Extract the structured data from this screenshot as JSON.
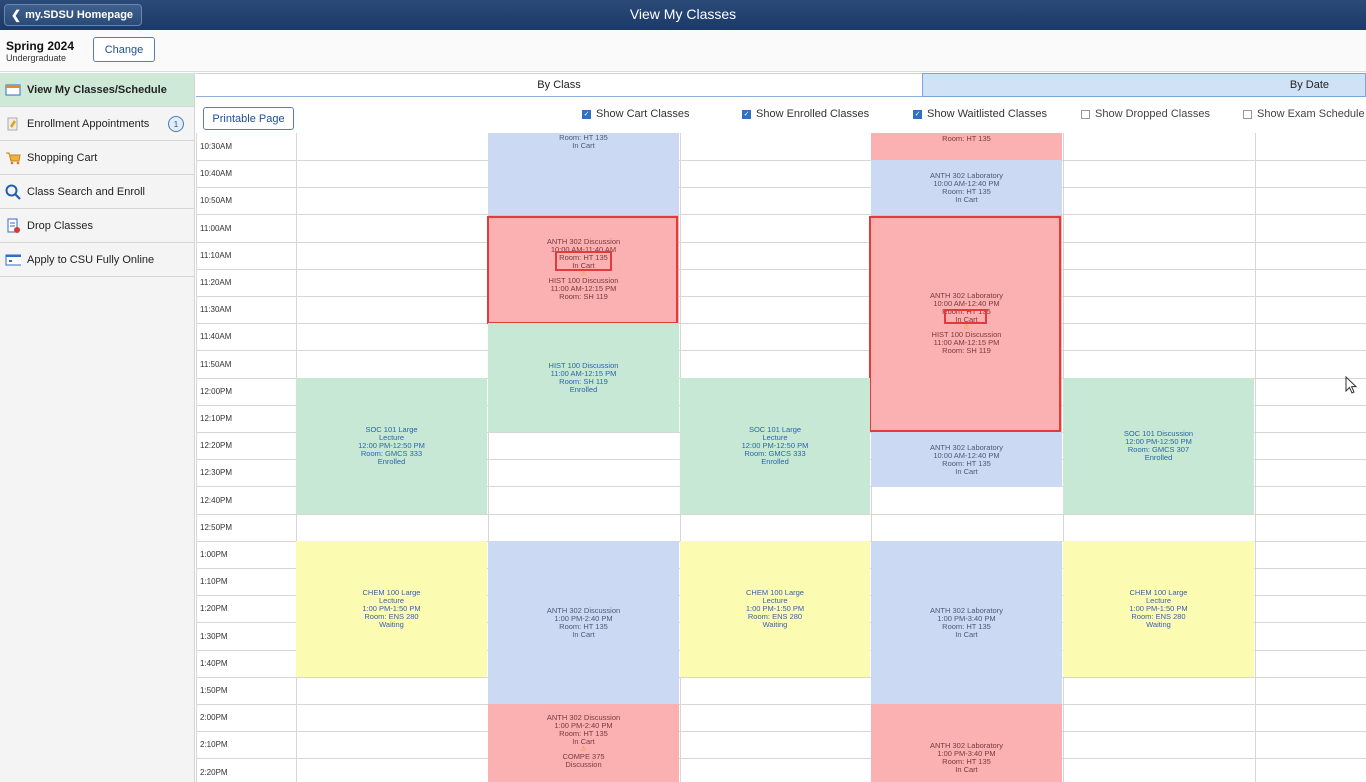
{
  "header": {
    "back_label": "my.SDSU Homepage",
    "title": "View My Classes"
  },
  "term": {
    "name": "Spring 2024",
    "career": "Undergraduate",
    "change_label": "Change"
  },
  "sidebar": {
    "items": [
      {
        "label": "View My Classes/Schedule",
        "icon": "calendar-icon"
      },
      {
        "label": "Enrollment Appointments",
        "icon": "appointment-icon",
        "badge": "1"
      },
      {
        "label": "Shopping Cart",
        "icon": "cart-icon"
      },
      {
        "label": "Class Search and Enroll",
        "icon": "search-icon"
      },
      {
        "label": "Drop Classes",
        "icon": "drop-icon"
      },
      {
        "label": "Apply to CSU Fully Online",
        "icon": "window-icon"
      }
    ]
  },
  "tabs": {
    "by_class": "By Class",
    "by_date": "By Date"
  },
  "toolbar": {
    "printable": "Printable Page",
    "options": [
      {
        "label": "Show Cart Classes",
        "checked": true
      },
      {
        "label": "Show Enrolled Classes",
        "checked": true
      },
      {
        "label": "Show Waitlisted Classes",
        "checked": true
      },
      {
        "label": "Show Dropped Classes",
        "checked": false
      },
      {
        "label": "Show Exam Schedule",
        "checked": false
      }
    ]
  },
  "times": [
    "10:30AM",
    "10:40AM",
    "10:50AM",
    "11:00AM",
    "11:10AM",
    "11:20AM",
    "11:30AM",
    "11:40AM",
    "11:50AM",
    "12:00PM",
    "12:10PM",
    "12:20PM",
    "12:30PM",
    "12:40PM",
    "12:50PM",
    "1:00PM",
    "1:10PM",
    "1:20PM",
    "1:30PM",
    "1:40PM",
    "1:50PM",
    "2:00PM",
    "2:10PM",
    "2:20PM"
  ],
  "blocks": {
    "tue_top": [
      "Room: HT 135",
      "In Cart"
    ],
    "tue_conflict_a": [
      "ANTH 302 Discussion",
      "10:00 AM-11:40 AM",
      "Room: HT 135"
    ],
    "tue_conflict_status": "In Cart",
    "tue_conflict_b": [
      "HIST 100 Discussion",
      "11:00 AM-12:15 PM",
      "Room: SH 119"
    ],
    "tue_hist": [
      "HIST 100 Discussion",
      "11:00 AM-12:15 PM",
      "Room: SH 119",
      "Enrolled"
    ],
    "thu_top": [
      "Room: HT 135"
    ],
    "thu_lab1": [
      "ANTH 302 Laboratory",
      "10:00 AM-12:40 PM",
      "Room: HT 135",
      "In Cart"
    ],
    "thu_conflict_a": [
      "ANTH 302 Laboratory",
      "10:00 AM-12:40 PM",
      "Room: HT 135"
    ],
    "thu_conflict_status": "In Cart",
    "thu_conflict_b": [
      "HIST 100 Discussion",
      "11:00 AM-12:15 PM",
      "Room: SH 119"
    ],
    "thu_lab2": [
      "ANTH 302 Laboratory",
      "10:00 AM-12:40 PM",
      "Room: HT 135",
      "In Cart"
    ],
    "mon_soc": [
      "SOC 101 Large",
      "Lecture",
      "12:00 PM-12:50 PM",
      "Room: GMCS 333",
      "Enrolled"
    ],
    "wed_soc": [
      "SOC 101 Large",
      "Lecture",
      "12:00 PM-12:50 PM",
      "Room: GMCS 333",
      "Enrolled"
    ],
    "fri_soc": [
      "SOC 101 Discussion",
      "12:00 PM-12:50 PM",
      "Room: GMCS 307",
      "Enrolled"
    ],
    "mon_chem": [
      "CHEM 100 Large",
      "Lecture",
      "1:00 PM-1:50 PM",
      "Room: ENS 280",
      "Waiting"
    ],
    "wed_chem": [
      "CHEM 100 Large",
      "Lecture",
      "1:00 PM-1:50 PM",
      "Room: ENS 280",
      "Waiting"
    ],
    "fri_chem": [
      "CHEM 100 Large",
      "Lecture",
      "1:00 PM-1:50 PM",
      "Room: ENS 280",
      "Waiting"
    ],
    "tue_anth": [
      "ANTH 302 Discussion",
      "1:00 PM-2:40 PM",
      "Room: HT 135",
      "In Cart"
    ],
    "thu_anth": [
      "ANTH 302 Laboratory",
      "1:00 PM-3:40 PM",
      "Room: HT 135",
      "In Cart"
    ],
    "tue_bottom": [
      "ANTH 302 Discussion",
      "1:00 PM-2:40 PM",
      "Room: HT 135",
      "In Cart"
    ],
    "tue_bottom_b": [
      "COMPE 375",
      "Discussion"
    ],
    "thu_bottom": [
      "ANTH 302 Laboratory",
      "1:00 PM-3:40 PM",
      "Room: HT 135",
      "In Cart"
    ]
  }
}
